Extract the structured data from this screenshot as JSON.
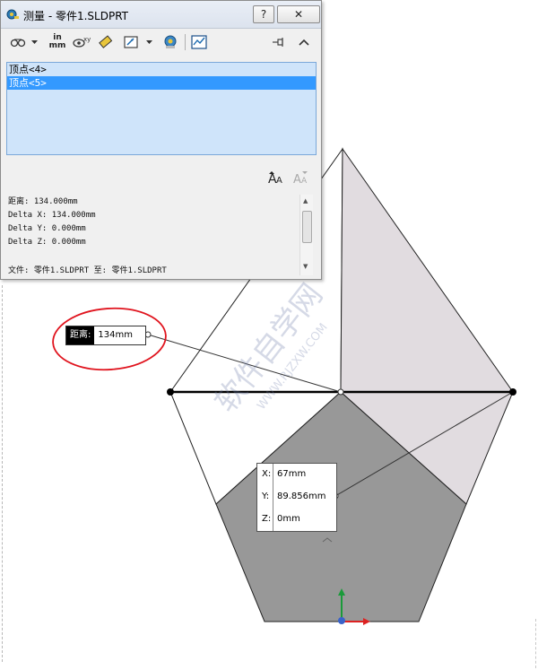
{
  "dialog": {
    "title": "测量 - 零件1.SLDPRT",
    "help_label": "?",
    "close_label": "✕",
    "toolbar": {
      "units_label_top": "in",
      "units_label_bottom": "mm"
    },
    "selections": [
      "顶点<4>",
      "顶点<5>"
    ],
    "selected_index": 1,
    "results": {
      "distance": "距离: 134.000mm",
      "delta_x": "Delta X: 134.000mm",
      "delta_y": "Delta Y: 0.000mm",
      "delta_z": "Delta Z: 0.000mm"
    },
    "file_line": "文件: 零件1.SLDPRT 至: 零件1.SLDPRT"
  },
  "callout": {
    "key": "距离:",
    "value": "134mm"
  },
  "coords": {
    "x_label": "X:",
    "x_value": "67mm",
    "y_label": "Y:",
    "y_value": "89.856mm",
    "z_label": "Z:",
    "z_value": "0mm"
  },
  "watermark": {
    "cn": "软件自学网",
    "url": "WWW.RJZXW.COM"
  },
  "colors": {
    "face_dark": "#989898",
    "face_light": "#e1dce0",
    "highlight_ring": "#e0141e",
    "list_bg": "#cfe4fa",
    "list_selected": "#3399ff"
  }
}
